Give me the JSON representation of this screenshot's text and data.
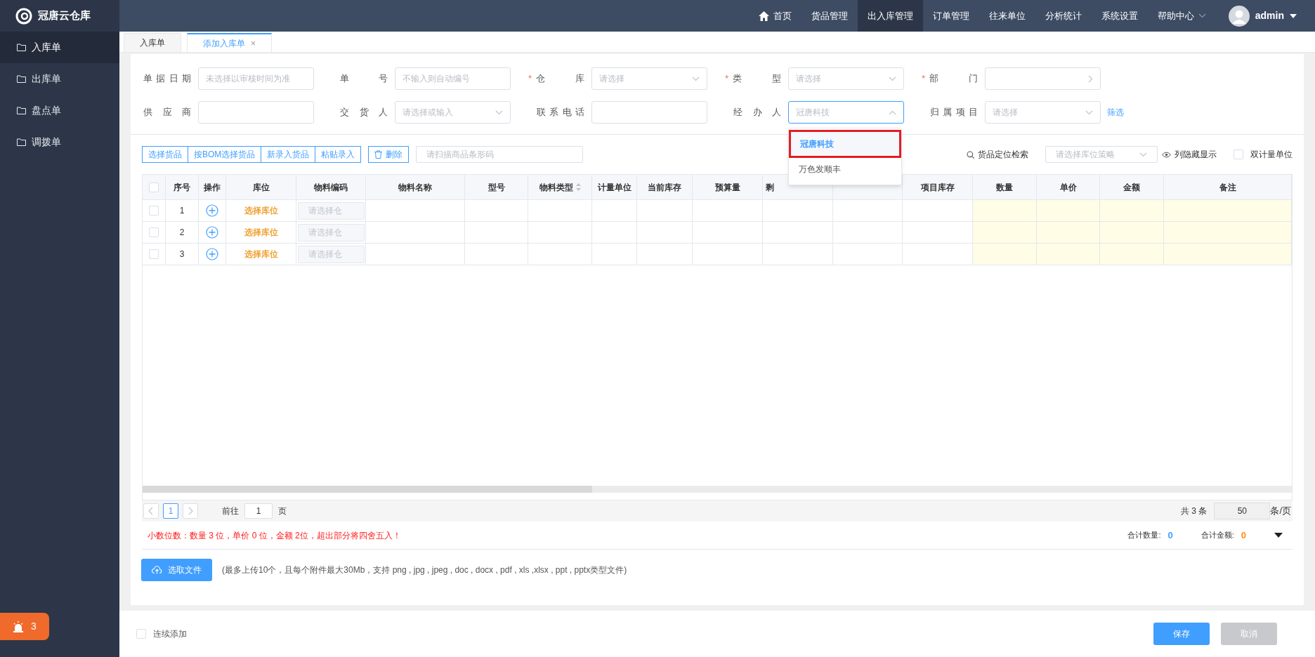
{
  "app": {
    "title": "冠唐云仓库"
  },
  "nav": [
    {
      "label": "首页",
      "kind": "home",
      "selected": false
    },
    {
      "label": "货品管理",
      "kind": "plain",
      "selected": false
    },
    {
      "label": "出入库管理",
      "kind": "plain",
      "selected": true
    },
    {
      "label": "订单管理",
      "kind": "plain",
      "selected": false
    },
    {
      "label": "往来单位",
      "kind": "plain",
      "selected": false
    },
    {
      "label": "分析统计",
      "kind": "plain",
      "selected": false
    },
    {
      "label": "系统设置",
      "kind": "plain",
      "selected": false
    },
    {
      "label": "帮助中心",
      "kind": "menu",
      "selected": false
    }
  ],
  "user": {
    "name": "admin"
  },
  "sidebar": {
    "items": [
      {
        "label": "入库单",
        "selected": true
      },
      {
        "label": "出库单",
        "selected": false
      },
      {
        "label": "盘点单",
        "selected": false
      },
      {
        "label": "调拨单",
        "selected": false
      }
    ]
  },
  "alert_badge": {
    "count": "3"
  },
  "tabs": [
    {
      "label": "入库单",
      "selected": false
    },
    {
      "label": "添加入库单",
      "selected": true,
      "close": "×"
    }
  ],
  "form": {
    "rows": [
      [
        {
          "label": "单据日期",
          "kind": "input",
          "placeholder": "未选择以审核时间为准"
        },
        {
          "label": "单号",
          "kind": "input",
          "placeholder": "不输入则自动编号"
        },
        {
          "required_mark": "*",
          "label": "仓库",
          "kind": "select",
          "placeholder": "请选择"
        },
        {
          "required_mark": "*",
          "label": "类型",
          "kind": "select",
          "placeholder": "请选择"
        },
        {
          "required_mark": "*",
          "label": "部门",
          "kind": "picker"
        }
      ],
      [
        {
          "label": "供应商",
          "kind": "input"
        },
        {
          "label": "交货人",
          "kind": "select",
          "placeholder": "请选择或输入"
        },
        {
          "label": "联系电话",
          "kind": "input"
        },
        {
          "label": "经办人",
          "kind": "select",
          "value": "冠唐科技",
          "expanded": true
        },
        {
          "label": "归属项目",
          "kind": "select",
          "placeholder": "请选择"
        }
      ]
    ],
    "filter_link": "筛选"
  },
  "dropdown": {
    "options": [
      {
        "label": "冠唐科技",
        "selected": true
      },
      {
        "label": "万色发顺丰",
        "selected": false
      }
    ]
  },
  "toolbar": {
    "buttons": [
      "选择货品",
      "按BOM选择货品",
      "新录入货品",
      "粘贴录入"
    ],
    "delete": "删除",
    "scan": {
      "placeholder": "请扫描商品条形码"
    },
    "locate": "货品定位检索",
    "strategy": {
      "placeholder": "请选择库位策略"
    },
    "columns_toggle": "列隐藏显示",
    "dual_unit": {
      "label": "双计量单位",
      "checked": false
    }
  },
  "table": {
    "all_checked": false,
    "columns": [
      {
        "label": "序号"
      },
      {
        "label": "操作"
      },
      {
        "label": "库位"
      },
      {
        "label": "物料编码"
      },
      {
        "label": "物料名称"
      },
      {
        "label": "型号"
      },
      {
        "label": "物料类型",
        "sortable": true
      },
      {
        "label": "计量单位"
      },
      {
        "label": "当前库存"
      },
      {
        "label": "预算量"
      },
      {
        "label": "剩",
        "kind": "covered"
      },
      {},
      {
        "label": "项目库存"
      },
      {
        "label": "数量",
        "editable": true
      },
      {
        "label": "单价",
        "editable": true
      },
      {
        "label": "金额",
        "editable": true
      },
      {
        "label": "备注",
        "editable": true
      }
    ],
    "rows": [
      {
        "no": "1",
        "location": "选择库位",
        "code_placeholder": "请选择仓",
        "checked": false
      },
      {
        "no": "2",
        "location": "选择库位",
        "code_placeholder": "请选择仓",
        "checked": false
      },
      {
        "no": "3",
        "location": "选择库位",
        "code_placeholder": "请选择仓",
        "checked": false
      }
    ]
  },
  "pagination": {
    "pages": [
      {
        "label": "1",
        "selected": true
      }
    ],
    "goto_label": "前往",
    "goto_value": "1",
    "page_suffix": "页",
    "total": "共 3 条",
    "page_size": "50",
    "size_suffix": "条/页"
  },
  "notice": "小数位数：数量 3 位，单价 0 位，金额 2位，超出部分将四舍五入！",
  "totals": [
    {
      "label": "合计数量:",
      "value": "0",
      "color": "#409eff"
    },
    {
      "label": "合计金额:",
      "value": "0",
      "color": "#ff8c1a"
    }
  ],
  "upload": {
    "button": "选取文件",
    "hint": "(最多上传10个，且每个附件最大30Mb，支持 png , jpg , jpeg , doc , docx , pdf , xls ,xlsx , ppt , pptx类型文件)"
  },
  "footer": {
    "continuous": {
      "label": "连续添加",
      "checked": false
    },
    "save": "保存",
    "cancel": {
      "label": "取消",
      "disabled": true
    }
  }
}
